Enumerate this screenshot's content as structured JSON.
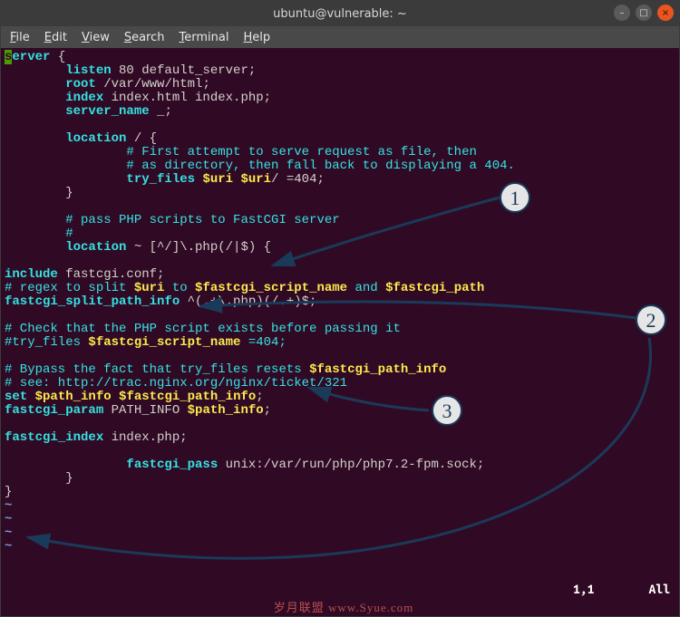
{
  "titlebar": {
    "title": "ubuntu@vulnerable: ~"
  },
  "menubar": {
    "items": [
      {
        "ul": "F",
        "rest": "ile"
      },
      {
        "ul": "E",
        "rest": "dit"
      },
      {
        "ul": "V",
        "rest": "iew"
      },
      {
        "ul": "S",
        "rest": "earch"
      },
      {
        "ul": "T",
        "rest": "erminal"
      },
      {
        "ul": "H",
        "rest": "elp"
      }
    ]
  },
  "code": {
    "l0_a": "s",
    "l0_b": "erver",
    "l0_c": " {",
    "l1_a": "        listen",
    "l1_b": " 80 default_server;",
    "l2_a": "        root",
    "l2_b": " /var/www/html;",
    "l3_a": "        index",
    "l3_b": " index.html index.php;",
    "l4_a": "        server_name",
    "l4_b": " _;",
    "l5": "",
    "l6_a": "        location",
    "l6_b": " / {",
    "l7": "                # First attempt to serve request as file, then",
    "l8": "                # as directory, then fall back to displaying a 404.",
    "l9_a": "                try_files",
    "l9_b": " ",
    "l9_c": "$uri",
    "l9_d": " ",
    "l9_e": "$uri",
    "l9_f": "/ =404;",
    "l10": "        }",
    "l11": "",
    "l12": "        # pass PHP scripts to FastCGI server",
    "l13": "        #",
    "l14_a": "        location",
    "l14_b": " ~ [^/]\\.php(/|$) {",
    "l15": "",
    "l16_a": "include",
    "l16_b": " fastcgi.conf;",
    "l17_a": "# regex to split ",
    "l17_b": "$uri",
    "l17_c": " to ",
    "l17_d": "$fastcgi_script_name",
    "l17_e": " and ",
    "l17_f": "$fastcgi_path",
    "l18_a": "fastcgi_split_path_info",
    "l18_b": " ^(.+\\.php)(/.+)$;",
    "l19": "",
    "l20": "# Check that the PHP script exists before passing it",
    "l21_a": "#try_files ",
    "l21_b": "$fastcgi_script_name",
    "l21_c": " =404;",
    "l22": "",
    "l23_a": "# Bypass the fact that try_files resets ",
    "l23_b": "$fastcgi_path_info",
    "l24": "# see: http://trac.nginx.org/nginx/ticket/321",
    "l25_a": "set",
    "l25_b": " ",
    "l25_c": "$path_info",
    "l25_d": " ",
    "l25_e": "$fastcgi_path_info",
    "l25_f": ";",
    "l26_a": "fastcgi_param",
    "l26_b": " PATH_INFO ",
    "l26_c": "$path_info",
    "l26_d": ";",
    "l27": "",
    "l28_a": "fastcgi_index",
    "l28_b": " index.php;",
    "l29": "",
    "l30_a": "                fastcgi_pass",
    "l30_b": " unix:/var/run/php/php7.2-fpm.sock;",
    "l31": "        }",
    "l32": "}",
    "tilde": "~"
  },
  "status": {
    "pos": "1,1",
    "mode": "All"
  },
  "watermark": "岁月联盟  www.Syue.com",
  "annot": {
    "n1": "1",
    "n2": "2",
    "n3": "3"
  }
}
